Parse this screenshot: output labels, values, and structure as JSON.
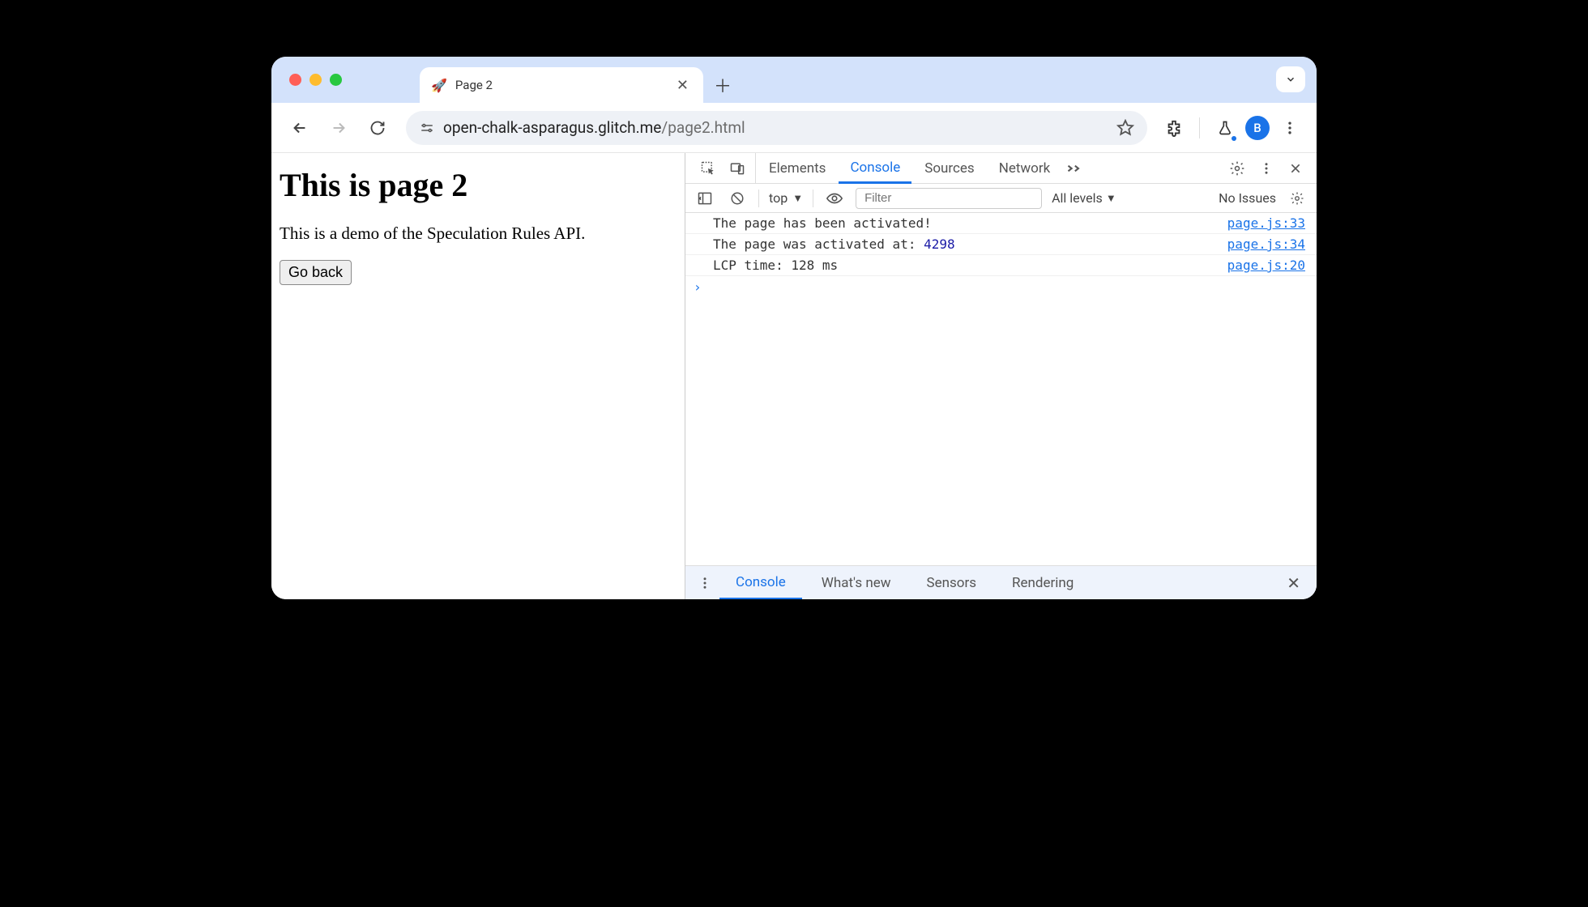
{
  "browser": {
    "tab": {
      "icon": "🚀",
      "title": "Page 2"
    },
    "url_host": "open-chalk-asparagus.glitch.me",
    "url_path": "/page2.html",
    "profile_initial": "B"
  },
  "page": {
    "heading": "This is page 2",
    "body": "This is a demo of the Speculation Rules API.",
    "back_button": "Go back"
  },
  "devtools": {
    "tabs": {
      "elements": "Elements",
      "console": "Console",
      "sources": "Sources",
      "network": "Network"
    },
    "console_toolbar": {
      "context": "top",
      "filter_placeholder": "Filter",
      "levels": "All levels",
      "issues": "No Issues"
    },
    "logs": [
      {
        "msg": "The page has been activated!",
        "num": null,
        "src": "page.js:33"
      },
      {
        "msg": "The page was activated at: ",
        "num": "4298",
        "src": "page.js:34"
      },
      {
        "msg": "LCP time: 128 ms",
        "num": null,
        "src": "page.js:20"
      }
    ],
    "drawer": {
      "console": "Console",
      "whatsnew": "What's new",
      "sensors": "Sensors",
      "rendering": "Rendering"
    }
  }
}
